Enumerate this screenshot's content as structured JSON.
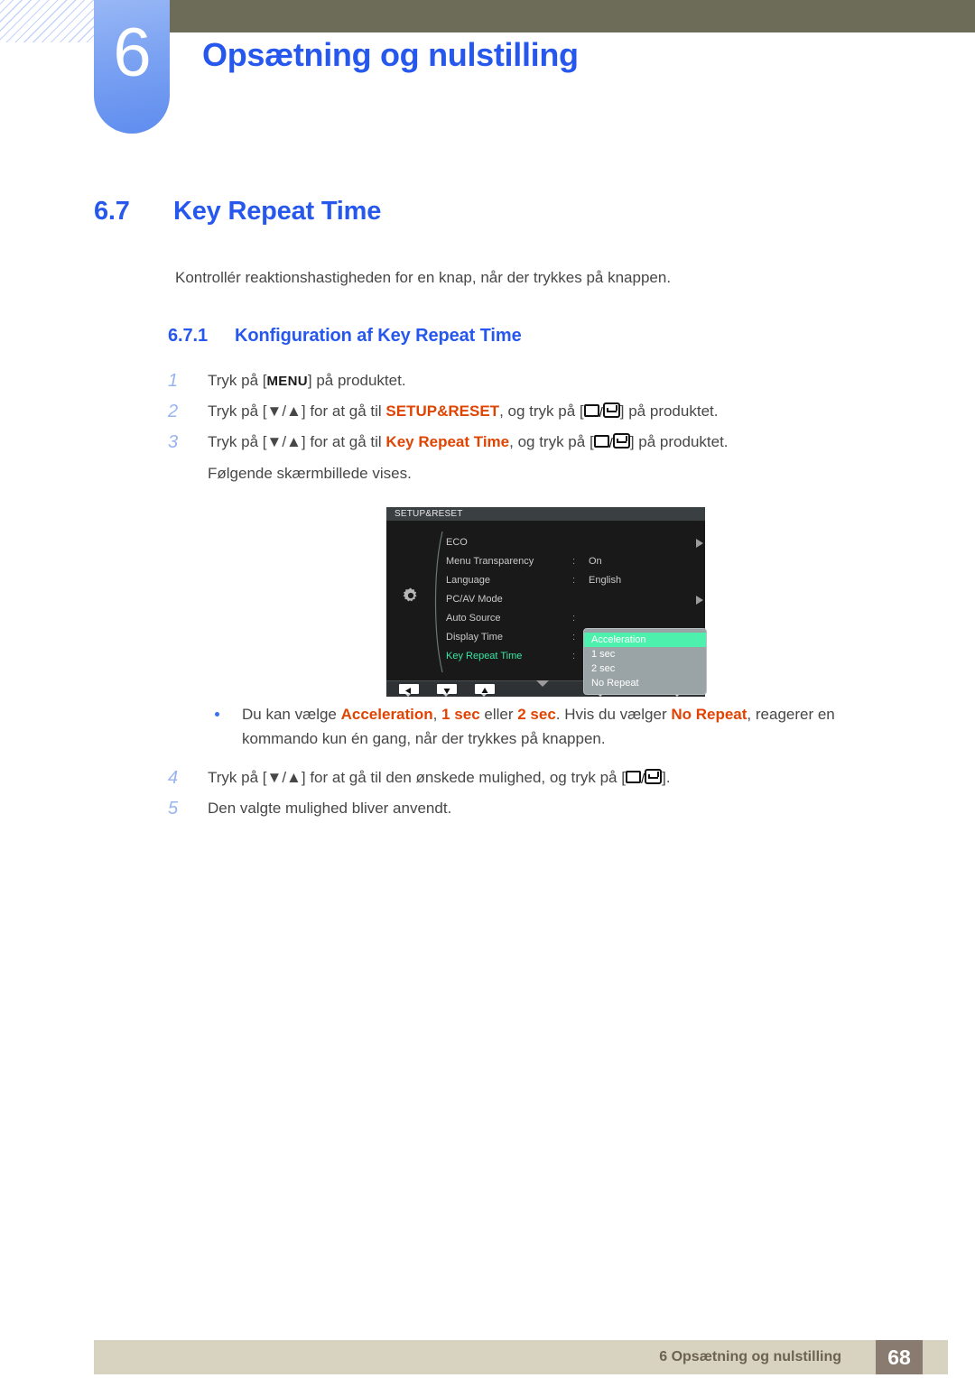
{
  "header": {
    "chapter_number": "6",
    "chapter_title": "Opsætning og nulstilling"
  },
  "section": {
    "number": "6.7",
    "title": "Key Repeat Time",
    "intro": "Kontrollér reaktionshastigheden for en knap, når der trykkes på knappen."
  },
  "subsection": {
    "number": "6.7.1",
    "title": "Konfiguration af Key Repeat Time"
  },
  "steps": [
    {
      "num": "1",
      "pre": "Tryk på [",
      "key": "MENU",
      "post": "] på produktet."
    },
    {
      "num": "2",
      "pre": "Tryk på [▼/▲] for at gå til ",
      "kw": "SETUP&RESET",
      "mid": ", og tryk på [",
      "post": "] på produktet."
    },
    {
      "num": "3",
      "pre": "Tryk på [▼/▲] for at gå til ",
      "kw": "Key Repeat Time",
      "mid": ", og tryk på [",
      "post": "] på produktet.",
      "sub": "Følgende skærmbillede vises."
    },
    {
      "num": "4",
      "pre": "Tryk på [▼/▲] for at gå til den ønskede mulighed, og tryk på [",
      "post": "]."
    },
    {
      "num": "5",
      "pre": "Den valgte mulighed bliver anvendt."
    }
  ],
  "bullet": {
    "p1": "Du kan vælge ",
    "kw1": "Acceleration",
    "p2": ", ",
    "kw2": "1 sec",
    "p3": " eller ",
    "kw3": "2 sec",
    "p4": ". Hvis du vælger ",
    "kw4": "No Repeat",
    "p5": ", reagerer en kommando kun én gang, når der trykkes på knappen."
  },
  "osd": {
    "title": "SETUP&RESET",
    "rows": [
      {
        "label": "ECO",
        "colon": "",
        "value": "",
        "arrow": true,
        "active": false
      },
      {
        "label": "Menu Transparency",
        "colon": ":",
        "value": "On",
        "arrow": false,
        "active": false
      },
      {
        "label": "Language",
        "colon": ":",
        "value": "English",
        "arrow": false,
        "active": false
      },
      {
        "label": "PC/AV Mode",
        "colon": "",
        "value": "",
        "arrow": true,
        "active": false
      },
      {
        "label": "Auto Source",
        "colon": ":",
        "value": "",
        "arrow": false,
        "active": false
      },
      {
        "label": "Display Time",
        "colon": ":",
        "value": "",
        "arrow": false,
        "active": false
      },
      {
        "label": "Key Repeat Time",
        "colon": ":",
        "value": "",
        "arrow": false,
        "active": true
      }
    ],
    "dropdown": {
      "items": [
        "Acceleration",
        "1 sec",
        "2 sec",
        "No Repeat"
      ],
      "selected": "Acceleration",
      "selected_color": "#4ef0ad"
    },
    "buttons": [
      {
        "name": "left",
        "glyph": "◀"
      },
      {
        "name": "down",
        "glyph": "▼"
      },
      {
        "name": "up",
        "glyph": "▲"
      },
      {
        "name": "enter",
        "glyph": "↵"
      },
      {
        "name": "power",
        "glyph": "⏻"
      }
    ]
  },
  "footer": {
    "text": "6 Opsætning og nulstilling",
    "page": "68"
  },
  "colors": {
    "accent_blue": "#2758ee",
    "keyword_red": "#e04403",
    "olive": "#6d6c58",
    "footer_beige": "#d8d2c0",
    "footer_brown": "#8a7b70",
    "osd_highlight": "#3be6a4"
  }
}
